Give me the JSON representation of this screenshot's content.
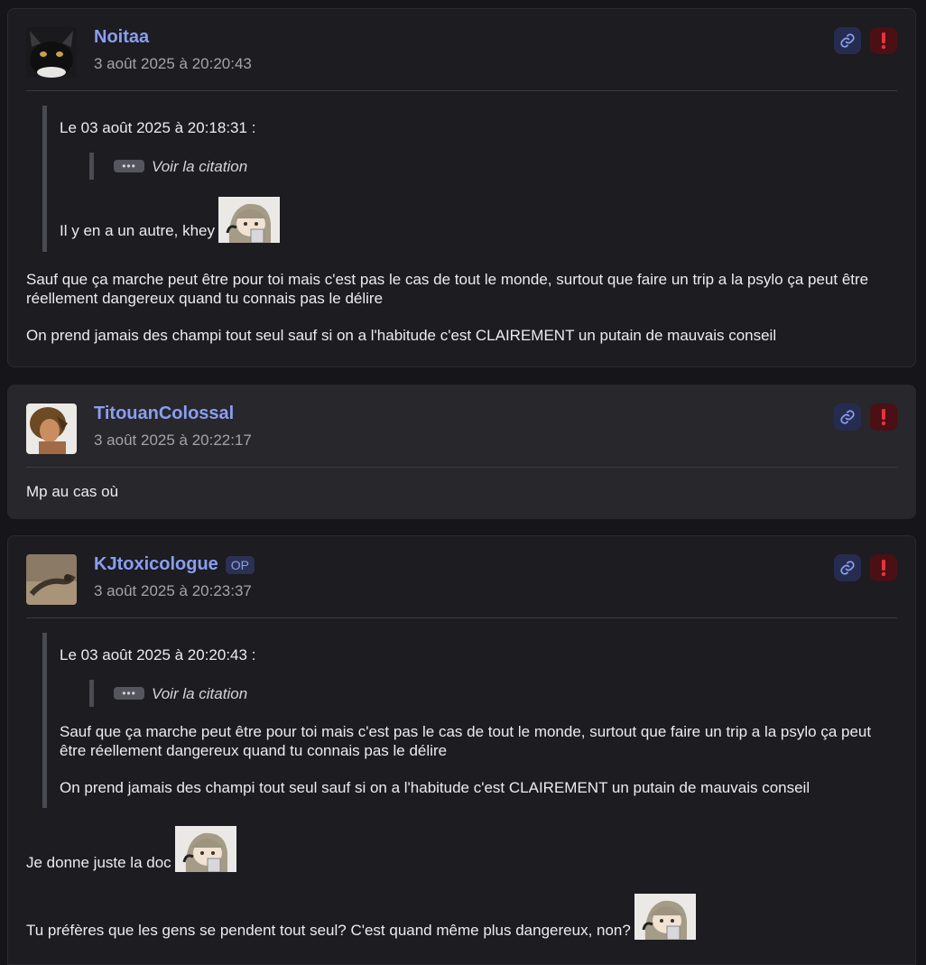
{
  "posts": [
    {
      "author": "Noitaa",
      "date": "3 août 2025 à 20:20:43",
      "quote_header": "Le 03 août 2025 à 20:18:31 :",
      "see_quote": "Voir la citation",
      "quote_text": "Il y en a un autre, khey",
      "paragraphs": [
        "Sauf que ça marche peut être pour toi mais c'est pas le cas de tout le monde, surtout que faire un trip a la psylo ça peut être réellement dangereux quand tu connais pas le délire",
        "On prend jamais des champi tout seul sauf si on a l'habitude c'est CLAIREMENT un putain de mauvais conseil"
      ]
    },
    {
      "author": "TitouanColossal",
      "date": "3 août 2025 à 20:22:17",
      "paragraphs": [
        "Mp au cas où"
      ]
    },
    {
      "author": "KJtoxicologue",
      "badge": "OP",
      "date": "3 août 2025 à 20:23:37",
      "quote_header": "Le 03 août 2025 à 20:20:43 :",
      "see_quote": "Voir la citation",
      "quote_paragraphs": [
        "Sauf que ça marche peut être pour toi mais c'est pas le cas de tout le monde, surtout que faire un trip a la psylo ça peut être réellement dangereux quand tu connais pas le délire",
        "On prend jamais des champi tout seul sauf si on a l'habitude c'est CLAIREMENT un putain de mauvais conseil"
      ],
      "paragraphs": [
        "Je donne juste la doc",
        "Tu préfères que les gens se pendent tout seul? C'est quand même plus dangereux, non?"
      ]
    }
  ],
  "icons": {
    "link": "link-icon",
    "report": "exclamation-icon",
    "ellipsis": "ellipsis-icon"
  },
  "colors": {
    "background": "#16161a",
    "card": "#1c1c21",
    "card_alt": "#27272c",
    "author": "#8a9ef0",
    "report_bg": "#4a1013",
    "report_fg": "#e3343f",
    "link_bg": "#262c4f"
  }
}
